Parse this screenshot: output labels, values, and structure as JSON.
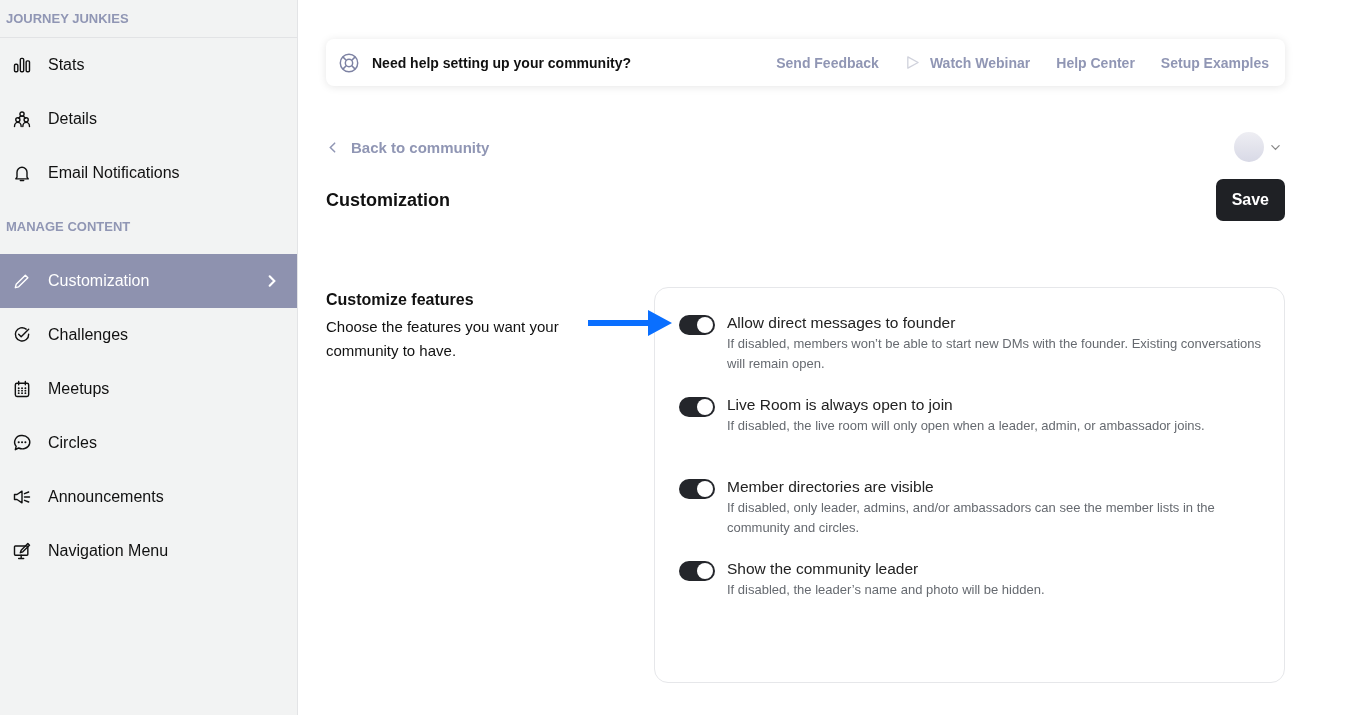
{
  "sidebar": {
    "sections": [
      {
        "title": "JOURNEY JUNKIES",
        "items": [
          {
            "label": "Stats",
            "selected": false
          },
          {
            "label": "Details",
            "selected": false
          },
          {
            "label": "Email Notifications",
            "selected": false
          }
        ]
      },
      {
        "title": "MANAGE CONTENT",
        "items": [
          {
            "label": "Customization",
            "selected": true
          },
          {
            "label": "Challenges",
            "selected": false
          },
          {
            "label": "Meetups",
            "selected": false
          },
          {
            "label": "Circles",
            "selected": false
          },
          {
            "label": "Announcements",
            "selected": false
          },
          {
            "label": "Navigation Menu",
            "selected": false
          }
        ]
      }
    ]
  },
  "help_bar": {
    "text": "Need help setting up your community?",
    "links": [
      {
        "label": "Send Feedback",
        "kind": "plain"
      },
      {
        "label": "Watch Webinar",
        "kind": "video"
      },
      {
        "label": "Help Center",
        "kind": "plain"
      },
      {
        "label": "Setup Examples",
        "kind": "plain"
      }
    ]
  },
  "back_link": "Back to community",
  "page_title": "Customization",
  "save_button": "Save",
  "features": {
    "title": "Customize features",
    "description": "Choose the features you want your community to have.",
    "toggles": [
      {
        "label": "Allow direct messages to founder",
        "description": "If disabled, members won’t be able to start new DMs with the founder. Existing conversations will remain open.",
        "on": true
      },
      {
        "label": "Live Room is always open to join",
        "description": "If disabled, the live room will only open when a leader, admin, or ambassador joins.",
        "on": true
      },
      {
        "label": "Member directories are visible",
        "description": "If disabled, only leader, admins, and/or ambassadors can see the member lists in the community and circles.",
        "on": true
      },
      {
        "label": "Show the community leader",
        "description": "If disabled, the leader’s name and photo will be hidden.",
        "on": true
      }
    ]
  }
}
